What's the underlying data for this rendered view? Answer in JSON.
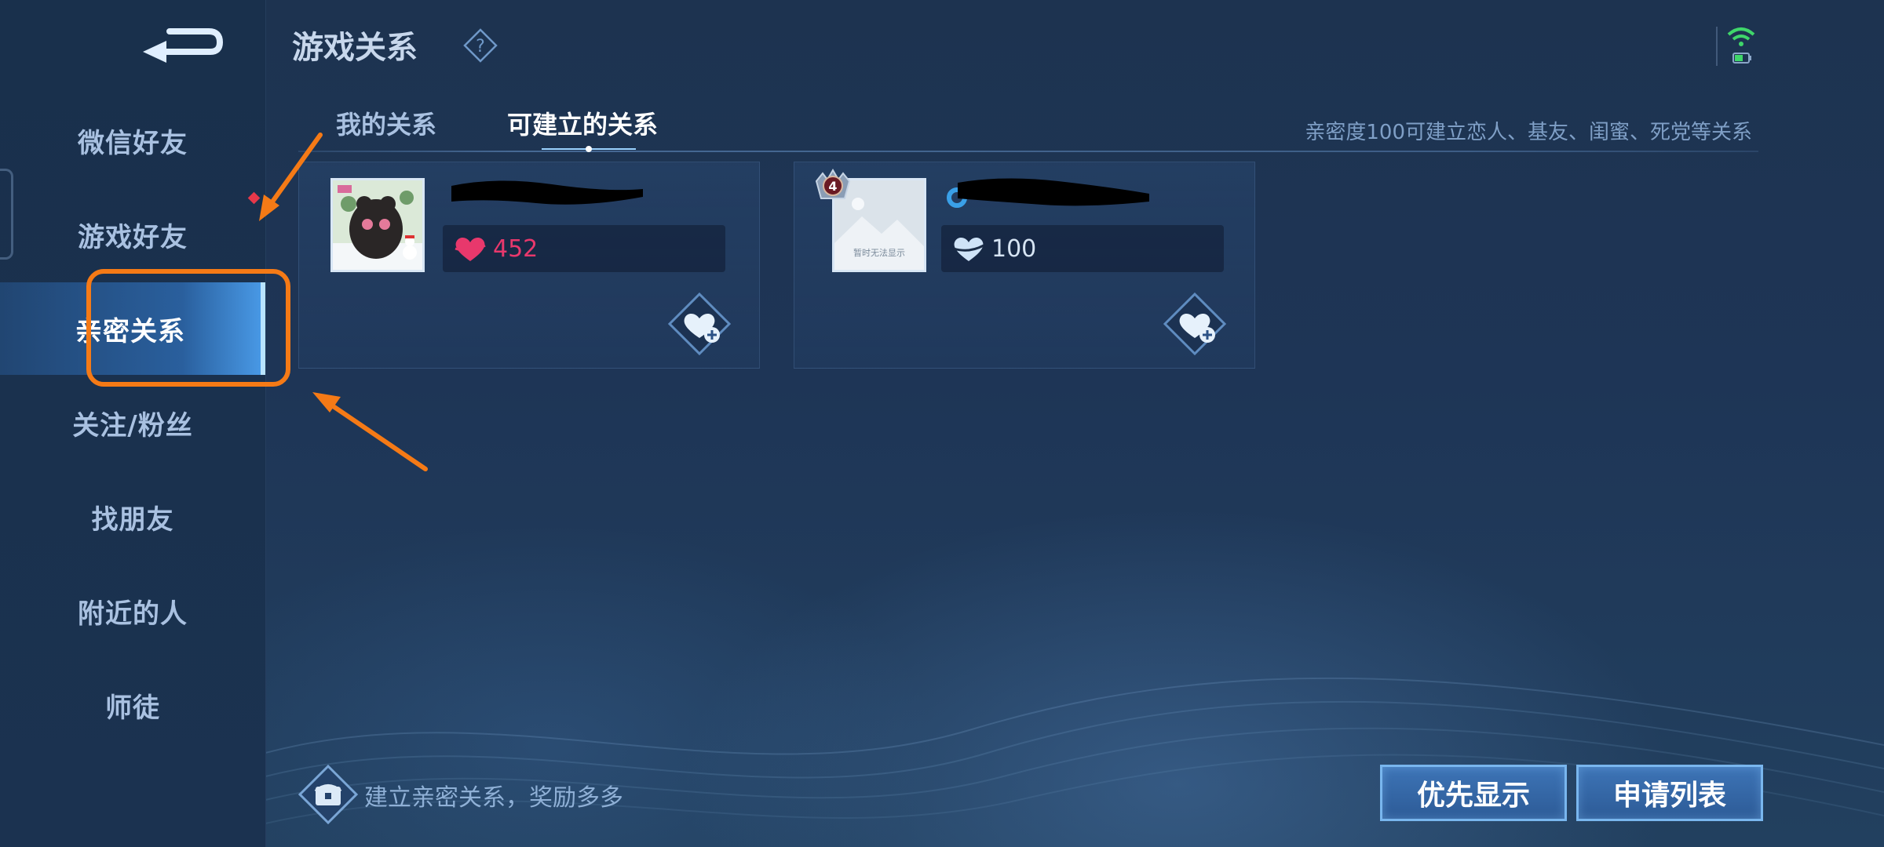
{
  "page": {
    "title": "游戏关系",
    "hint": "亲密度100可建立恋人、基友、闺蜜、死党等关系"
  },
  "sidebar": {
    "items": [
      {
        "label": "微信好友",
        "name": "sidebar-item-wechat-friends"
      },
      {
        "label": "游戏好友",
        "name": "sidebar-item-game-friends"
      },
      {
        "label": "亲密关系",
        "name": "sidebar-item-intimate-relations"
      },
      {
        "label": "关注/粉丝",
        "name": "sidebar-item-follow-fans"
      },
      {
        "label": "找朋友",
        "name": "sidebar-item-find-friends"
      },
      {
        "label": "附近的人",
        "name": "sidebar-item-nearby"
      },
      {
        "label": "师徒",
        "name": "sidebar-item-mentor"
      }
    ],
    "active_index": 2
  },
  "tabs": [
    {
      "label": "我的关系"
    },
    {
      "label": "可建立的关系"
    }
  ],
  "active_tab": 1,
  "cards": [
    {
      "intimacy": "452",
      "heart_color": "#e8386c",
      "value_color": "#e8386c"
    },
    {
      "intimacy": "100",
      "heart_color": "#cfe3f7",
      "value_color": "#d6e4f3",
      "level_badge": "4",
      "avatar_placeholder_text": "暂时无法显示"
    }
  ],
  "bottom": {
    "reward_text": "建立亲密关系，奖励多多",
    "priority_button": "优先显示",
    "request_list_button": "申请列表"
  },
  "colors": {
    "accent": "#79b6ee",
    "annotation": "#f57a16",
    "notification_dot": "#e7384a",
    "wifi": "#3fd66a"
  }
}
